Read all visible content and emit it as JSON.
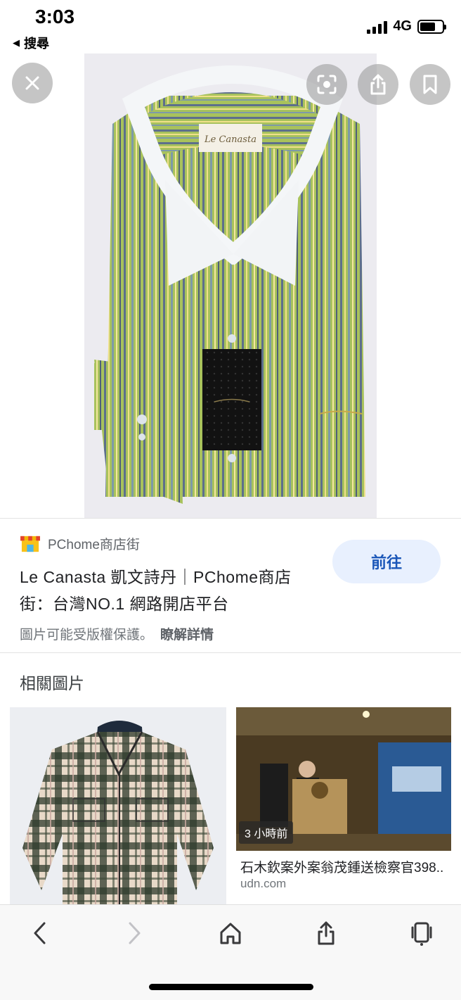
{
  "status_bar": {
    "time": "3:03",
    "back_app": "搜尋",
    "network": "4G",
    "battery_level": 0.7
  },
  "viewer": {
    "close_icon": "close-icon",
    "lens_icon": "lens-icon",
    "share_icon": "share-icon",
    "bookmark_icon": "bookmark-icon",
    "image_label": "Le Canasta"
  },
  "source": {
    "site_name": "PChome商店街",
    "title": "Le Canasta 凱文詩丹｜PChome商店街：台灣NO.1 網路開店平台",
    "go_button": "前往",
    "copyright": "圖片可能受版權保護。",
    "learn_more": "瞭解詳情"
  },
  "related": {
    "heading": "相關圖片",
    "items": [
      {
        "time_badge": "",
        "caption": "",
        "source": ""
      },
      {
        "time_badge": "3 小時前",
        "caption": "石木欽案外案翁茂鍾送檢察官398...",
        "source": "udn.com"
      }
    ]
  },
  "toolbar": {
    "back_icon": "chevron-left-icon",
    "forward_icon": "chevron-right-icon",
    "home_icon": "home-icon",
    "share_icon": "share-icon",
    "tabs_icon": "tabs-icon"
  },
  "colors": {
    "accent": "#1a56b8",
    "go_button_bg": "#e8f0fe",
    "shirt_green": "#a8c25c"
  }
}
